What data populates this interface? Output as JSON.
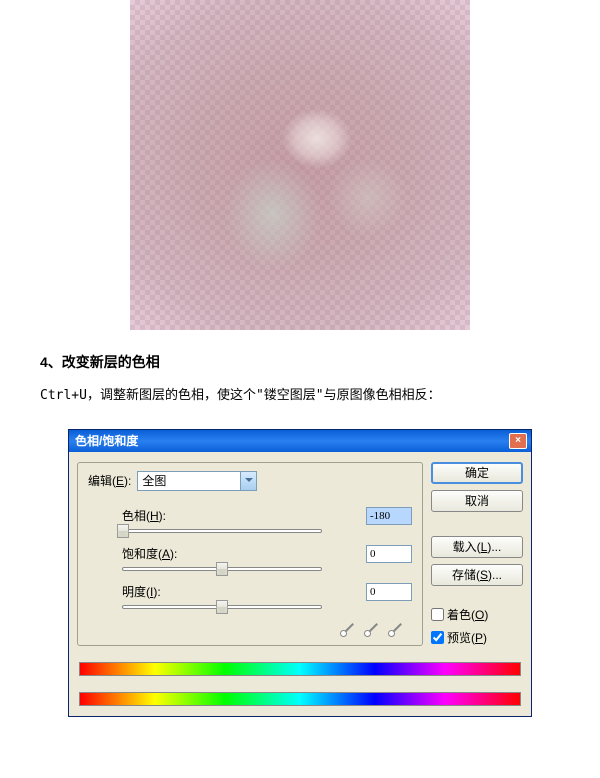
{
  "step": {
    "title": "4、改变新层的色相",
    "description_prefix": "Ctrl+U，调整新图层的色相，使这个",
    "description_quoted": "\"镂空图层\"",
    "description_suffix": "与原图像色相相反："
  },
  "dialog": {
    "title": "色相/饱和度",
    "edit_label": "编辑(E):",
    "edit_value": "全图",
    "hue": {
      "label": "色相(H):",
      "value": "-180",
      "pos": 0
    },
    "saturation": {
      "label": "饱和度(A):",
      "value": "0",
      "pos": 50
    },
    "lightness": {
      "label": "明度(I):",
      "value": "0",
      "pos": 50
    },
    "buttons": {
      "ok": "确定",
      "cancel": "取消",
      "load": "载入(L)...",
      "save": "存储(S)..."
    },
    "colorize_label": "着色(O)",
    "preview_label": "预览(P)",
    "preview_checked": true
  }
}
